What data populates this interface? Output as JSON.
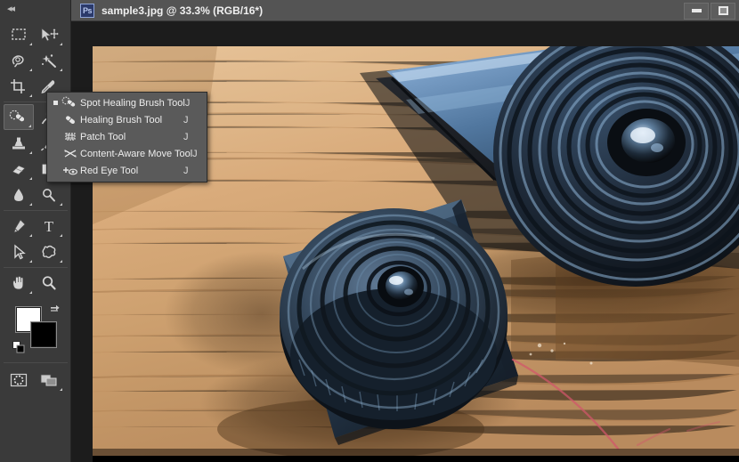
{
  "window": {
    "app_badge": "Ps",
    "title": "sample3.jpg @ 33.3% (RGB/16*)",
    "zoom_level": "33.3%",
    "color_mode": "RGB/16*",
    "file_name": "sample3.jpg",
    "minimize_label": "Minimize",
    "restore_label": "Restore",
    "titlebar_color": "#545454",
    "panel_color": "#3a3a3a",
    "canvas_bg_color": "#1c1c1c"
  },
  "toolbar": {
    "collapse_label": "«",
    "groups": [
      {
        "rows": [
          [
            {
              "name": "rectangular-marquee-tool",
              "icon": "marquee-icon",
              "has_flyout": true,
              "active": false
            },
            {
              "name": "move-tool",
              "icon": "move-icon",
              "has_flyout": true,
              "active": false
            }
          ],
          [
            {
              "name": "lasso-tool",
              "icon": "lasso-icon",
              "has_flyout": true,
              "active": false
            },
            {
              "name": "quick-selection-tool",
              "icon": "magic-wand-icon",
              "has_flyout": true,
              "active": false
            }
          ],
          [
            {
              "name": "crop-tool",
              "icon": "crop-icon",
              "has_flyout": true,
              "active": false
            },
            {
              "name": "eyedropper-tool",
              "icon": "eyedropper-icon",
              "has_flyout": true,
              "active": false
            }
          ]
        ]
      },
      {
        "rows": [
          [
            {
              "name": "spot-healing-brush-tool",
              "icon": "healing-brush-icon",
              "has_flyout": true,
              "active": true
            },
            {
              "name": "brush-tool",
              "icon": "brush-icon",
              "has_flyout": true,
              "active": false
            }
          ],
          [
            {
              "name": "clone-stamp-tool",
              "icon": "clone-stamp-icon",
              "has_flyout": true,
              "active": false
            },
            {
              "name": "history-brush-tool",
              "icon": "history-brush-icon",
              "has_flyout": true,
              "active": false
            }
          ],
          [
            {
              "name": "eraser-tool",
              "icon": "eraser-icon",
              "has_flyout": true,
              "active": false
            },
            {
              "name": "gradient-tool",
              "icon": "gradient-icon",
              "has_flyout": true,
              "active": false
            }
          ],
          [
            {
              "name": "blur-tool",
              "icon": "waterdrop-icon",
              "has_flyout": true,
              "active": false
            },
            {
              "name": "dodge-tool",
              "icon": "dodge-icon",
              "has_flyout": true,
              "active": false
            }
          ]
        ]
      },
      {
        "rows": [
          [
            {
              "name": "pen-tool",
              "icon": "pen-icon",
              "has_flyout": true,
              "active": false
            },
            {
              "name": "type-tool",
              "icon": "type-t-icon",
              "has_flyout": true,
              "active": false
            }
          ],
          [
            {
              "name": "path-selection-tool",
              "icon": "path-arrow-icon",
              "has_flyout": true,
              "active": false
            },
            {
              "name": "custom-shape-tool",
              "icon": "shape-blob-icon",
              "has_flyout": true,
              "active": false
            }
          ]
        ]
      },
      {
        "rows": [
          [
            {
              "name": "hand-tool",
              "icon": "hand-icon",
              "has_flyout": true,
              "active": false
            },
            {
              "name": "zoom-tool",
              "icon": "magnifier-icon",
              "has_flyout": false,
              "active": false
            }
          ]
        ]
      }
    ],
    "colors": {
      "foreground": "#ffffff",
      "background": "#000000",
      "foreground_name": "foreground-color-swatch",
      "background_name": "background-color-swatch",
      "swap_name": "swap-colors-icon",
      "default_name": "default-colors-icon"
    },
    "modes": [
      {
        "name": "quick-mask-button",
        "icon": "quick-mask-icon"
      },
      {
        "name": "screen-mode-button",
        "icon": "screen-mode-icon"
      }
    ]
  },
  "flyout_menu": {
    "name": "healing-tools-flyout",
    "items": [
      {
        "label": "Spot Healing Brush Tool",
        "shortcut": "J",
        "icon": "spot-healing-brush-icon",
        "selected": true
      },
      {
        "label": "Healing Brush Tool",
        "shortcut": "J",
        "icon": "healing-brush-icon",
        "selected": false
      },
      {
        "label": "Patch Tool",
        "shortcut": "J",
        "icon": "patch-icon",
        "selected": false
      },
      {
        "label": "Content-Aware Move Tool",
        "shortcut": "J",
        "icon": "content-aware-move-icon",
        "selected": false
      },
      {
        "label": "Red Eye Tool",
        "shortcut": "J",
        "icon": "red-eye-icon",
        "selected": false
      }
    ]
  },
  "document": {
    "image_description": "Photograph of a black camera lens standing on a wooden table with a dark camera body in the upper right and a faint red brush stroke on the wood",
    "image_alt": "sample3.jpg"
  }
}
